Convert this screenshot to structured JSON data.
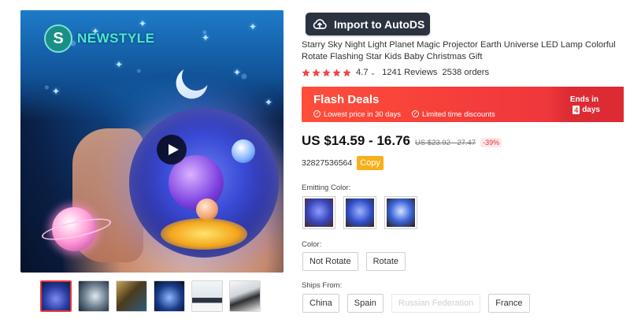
{
  "media": {
    "brand_name": "NEWSTYLE",
    "brand_initial": "S",
    "play_icon": "play-icon",
    "thumbnails": [
      {
        "name": "thumbnail-1",
        "active": true
      },
      {
        "name": "thumbnail-2",
        "active": false
      },
      {
        "name": "thumbnail-3",
        "active": false
      },
      {
        "name": "thumbnail-4",
        "active": false
      },
      {
        "name": "thumbnail-5",
        "active": false
      },
      {
        "name": "thumbnail-6",
        "active": false
      }
    ]
  },
  "toolbar": {
    "import_label": "Import to AutoDS",
    "import_icon": "cloud-upload-icon"
  },
  "product": {
    "title": "Starry Sky Night Light Planet Magic Projector Earth Universe LED Lamp Colorful Rotate Flashing Star Kids Baby Christmas Gift",
    "rating": "4.7",
    "rating_stars": 5,
    "reviews": "1241 Reviews",
    "orders": "2538 orders",
    "price": "US $14.59 - 16.76",
    "old_price": "US $23.92 - 27.47",
    "discount": "-39%",
    "product_id": "32827536564",
    "copy_label": "Copy"
  },
  "flash_deals": {
    "title": "Flash Deals",
    "benefit_1": "Lowest price in 30 days",
    "benefit_2": "Limited time discounts",
    "ends_label": "Ends in",
    "days_number": "4",
    "days_label": "days"
  },
  "options": {
    "emitting_color_label": "Emitting Color:",
    "color_label": "Color:",
    "color_options": [
      "Not Rotate",
      "Rotate"
    ],
    "ships_from_label": "Ships From:",
    "ships_from_options": [
      "China",
      "Spain",
      "Russian Federation",
      "France"
    ],
    "ships_from_disabled": [
      false,
      false,
      true,
      false
    ]
  },
  "colors": {
    "flash_red": "#f23b3b",
    "price_red": "#e7323a",
    "copy_orange": "#f7b01a",
    "import_dark": "#2b3340",
    "star_red": "#f04848"
  }
}
